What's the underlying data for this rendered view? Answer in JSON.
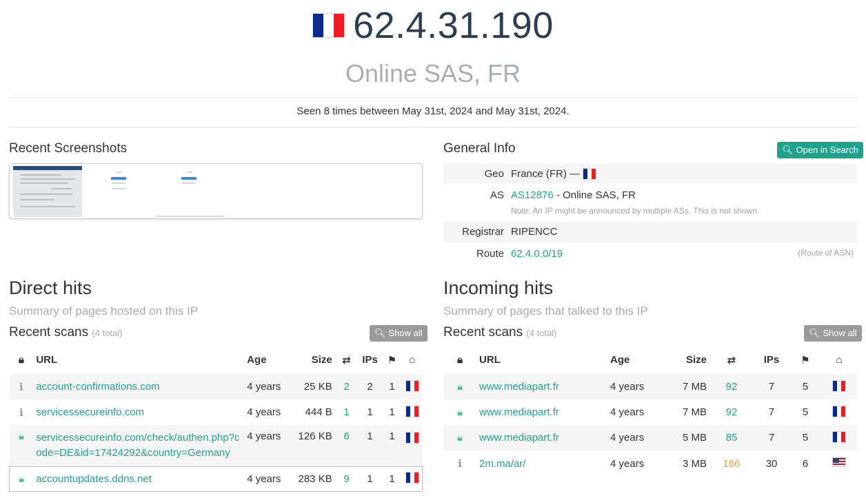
{
  "header": {
    "ip": "62.4.31.190",
    "org": "Online SAS, FR",
    "seen": "Seen 8 times between May 31st, 2024 and May 31st, 2024."
  },
  "screenshots": {
    "title": "Recent Screenshots"
  },
  "general_info": {
    "title": "General Info",
    "open_search_label": "Open in Search",
    "geo_label": "Geo",
    "geo_value": "France (FR) —",
    "as_label": "AS",
    "as_link": "AS12876",
    "as_rest": "- Online SAS, FR",
    "as_note": "Note: An IP might be announced by multiple ASs. This is not shown.",
    "registrar_label": "Registrar",
    "registrar_value": "RIPENCC",
    "route_label": "Route",
    "route_value": "62.4.0.0/19",
    "route_note": "(Route of ASN)"
  },
  "direct": {
    "title": "Direct hits",
    "subtitle": "Summary of pages hosted on this IP",
    "recent_label": "Recent scans",
    "total": "(4 total)",
    "show_all": "Show all",
    "columns": {
      "url": "URL",
      "age": "Age",
      "size": "Size",
      "ips": "IPs"
    },
    "rows": [
      {
        "icon": "info-icon",
        "url": "account-confirmations.com",
        "url2": "",
        "age": "4 years",
        "size": "25 KB",
        "req": "2",
        "ips": "2",
        "countries": "1",
        "flag": "fr"
      },
      {
        "icon": "info-icon",
        "url": "servicessecureinfo.com",
        "url2": "",
        "age": "4 years",
        "size": "444 B",
        "req": "1",
        "ips": "1",
        "countries": "1",
        "flag": "fr"
      },
      {
        "icon": "lock-icon",
        "url": "servicessecureinfo.com/check/authen.php?c",
        "url2": "ode=DE&id=17424292&country=Germany",
        "age": "4 years",
        "size": "126 KB",
        "req": "6",
        "ips": "1",
        "countries": "1",
        "flag": "fr"
      },
      {
        "icon": "lock-icon",
        "url": "accountupdates.ddns.net",
        "url2": "",
        "age": "4 years",
        "size": "283 KB",
        "req": "9",
        "ips": "1",
        "countries": "1",
        "flag": "fr"
      }
    ]
  },
  "incoming": {
    "title": "Incoming hits",
    "subtitle": "Summary of pages that talked to this IP",
    "recent_label": "Recent scans",
    "total": "(4 total)",
    "show_all": "Show all",
    "columns": {
      "url": "URL",
      "age": "Age",
      "size": "Size",
      "ips": "IPs"
    },
    "rows": [
      {
        "icon": "lock-icon",
        "url": "www.mediapart.fr",
        "age": "4 years",
        "size": "7 MB",
        "req": "92",
        "ips": "7",
        "countries": "5",
        "flag": "fr"
      },
      {
        "icon": "lock-icon",
        "url": "www.mediapart.fr",
        "age": "4 years",
        "size": "7 MB",
        "req": "92",
        "ips": "7",
        "countries": "5",
        "flag": "fr"
      },
      {
        "icon": "lock-icon",
        "url": "www.mediapart.fr",
        "age": "4 years",
        "size": "5 MB",
        "req": "85",
        "ips": "7",
        "countries": "5",
        "flag": "fr"
      },
      {
        "icon": "info-icon",
        "url": "2m.ma/ar/",
        "age": "4 years",
        "size": "3 MB",
        "req": "166",
        "ips": "30",
        "countries": "6",
        "flag": "us"
      }
    ]
  }
}
